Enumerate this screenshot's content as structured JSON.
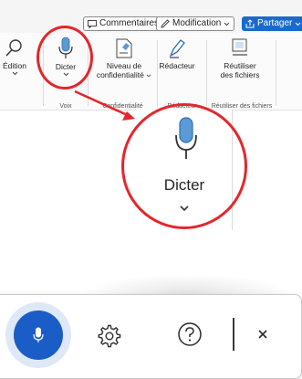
{
  "top_buttons": {
    "comments": "Commentaires",
    "modification": "Modification",
    "share": "Partager"
  },
  "ribbon": {
    "edition": "Édition",
    "dicter": "Dicter",
    "niveau_line1": "Niveau de",
    "niveau_line2": "confidentialité",
    "redacteur": "Rédacteur",
    "reutiliser_line1": "Réutiliser",
    "reutiliser_line2": "des fichiers",
    "groups": {
      "voix": "Voix",
      "confidentialite": "Confidentialité",
      "redacteur": "Rédacteur",
      "reutiliser": "Réutiliser des fichiers"
    }
  },
  "callout": {
    "label": "Dicter"
  },
  "colors": {
    "accent": "#1a5dc7",
    "highlight": "#e4262b",
    "mic_icon": "#5b9bd5"
  },
  "icons": [
    "comment-icon",
    "pencil-icon",
    "share-icon",
    "search-icon",
    "microphone-icon",
    "sensitivity-icon",
    "editor-icon",
    "reuse-files-icon",
    "gear-icon",
    "help-icon",
    "close-icon"
  ]
}
